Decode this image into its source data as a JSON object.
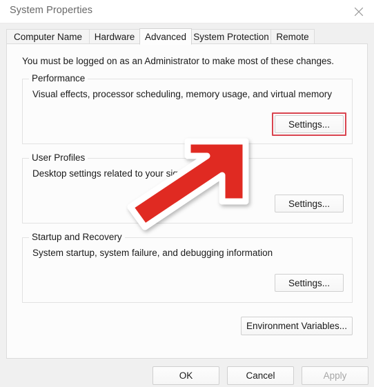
{
  "window": {
    "title": "System Properties",
    "close_icon": "close-icon"
  },
  "tabs": [
    {
      "label": "Computer Name",
      "active": false
    },
    {
      "label": "Hardware",
      "active": false
    },
    {
      "label": "Advanced",
      "active": true
    },
    {
      "label": "System Protection",
      "active": false
    },
    {
      "label": "Remote",
      "active": false
    }
  ],
  "panel": {
    "notice": "You must be logged on as an Administrator to make most of these changes.",
    "groups": [
      {
        "title": "Performance",
        "description": "Visual effects, processor scheduling, memory usage, and virtual memory",
        "button_label": "Settings...",
        "highlighted": true
      },
      {
        "title": "User Profiles",
        "description": "Desktop settings related to your sign-in",
        "button_label": "Settings...",
        "highlighted": false
      },
      {
        "title": "Startup and Recovery",
        "description": "System startup, system failure, and debugging information",
        "button_label": "Settings...",
        "highlighted": false
      }
    ],
    "environment_variables_label": "Environment Variables..."
  },
  "footer": {
    "ok_label": "OK",
    "cancel_label": "Cancel",
    "apply_label": "Apply",
    "apply_disabled": true
  },
  "annotation": {
    "arrow_icon": "arrow-up-right-icon",
    "arrow_color": "#e02b20",
    "arrow_outline_color": "#ffffff",
    "points_to": "Settings..."
  },
  "colors": {
    "highlight": "#d9444f",
    "window_background": "#f0f0f0",
    "panel_background": "#fcfcfc",
    "title_text": "#686868"
  }
}
